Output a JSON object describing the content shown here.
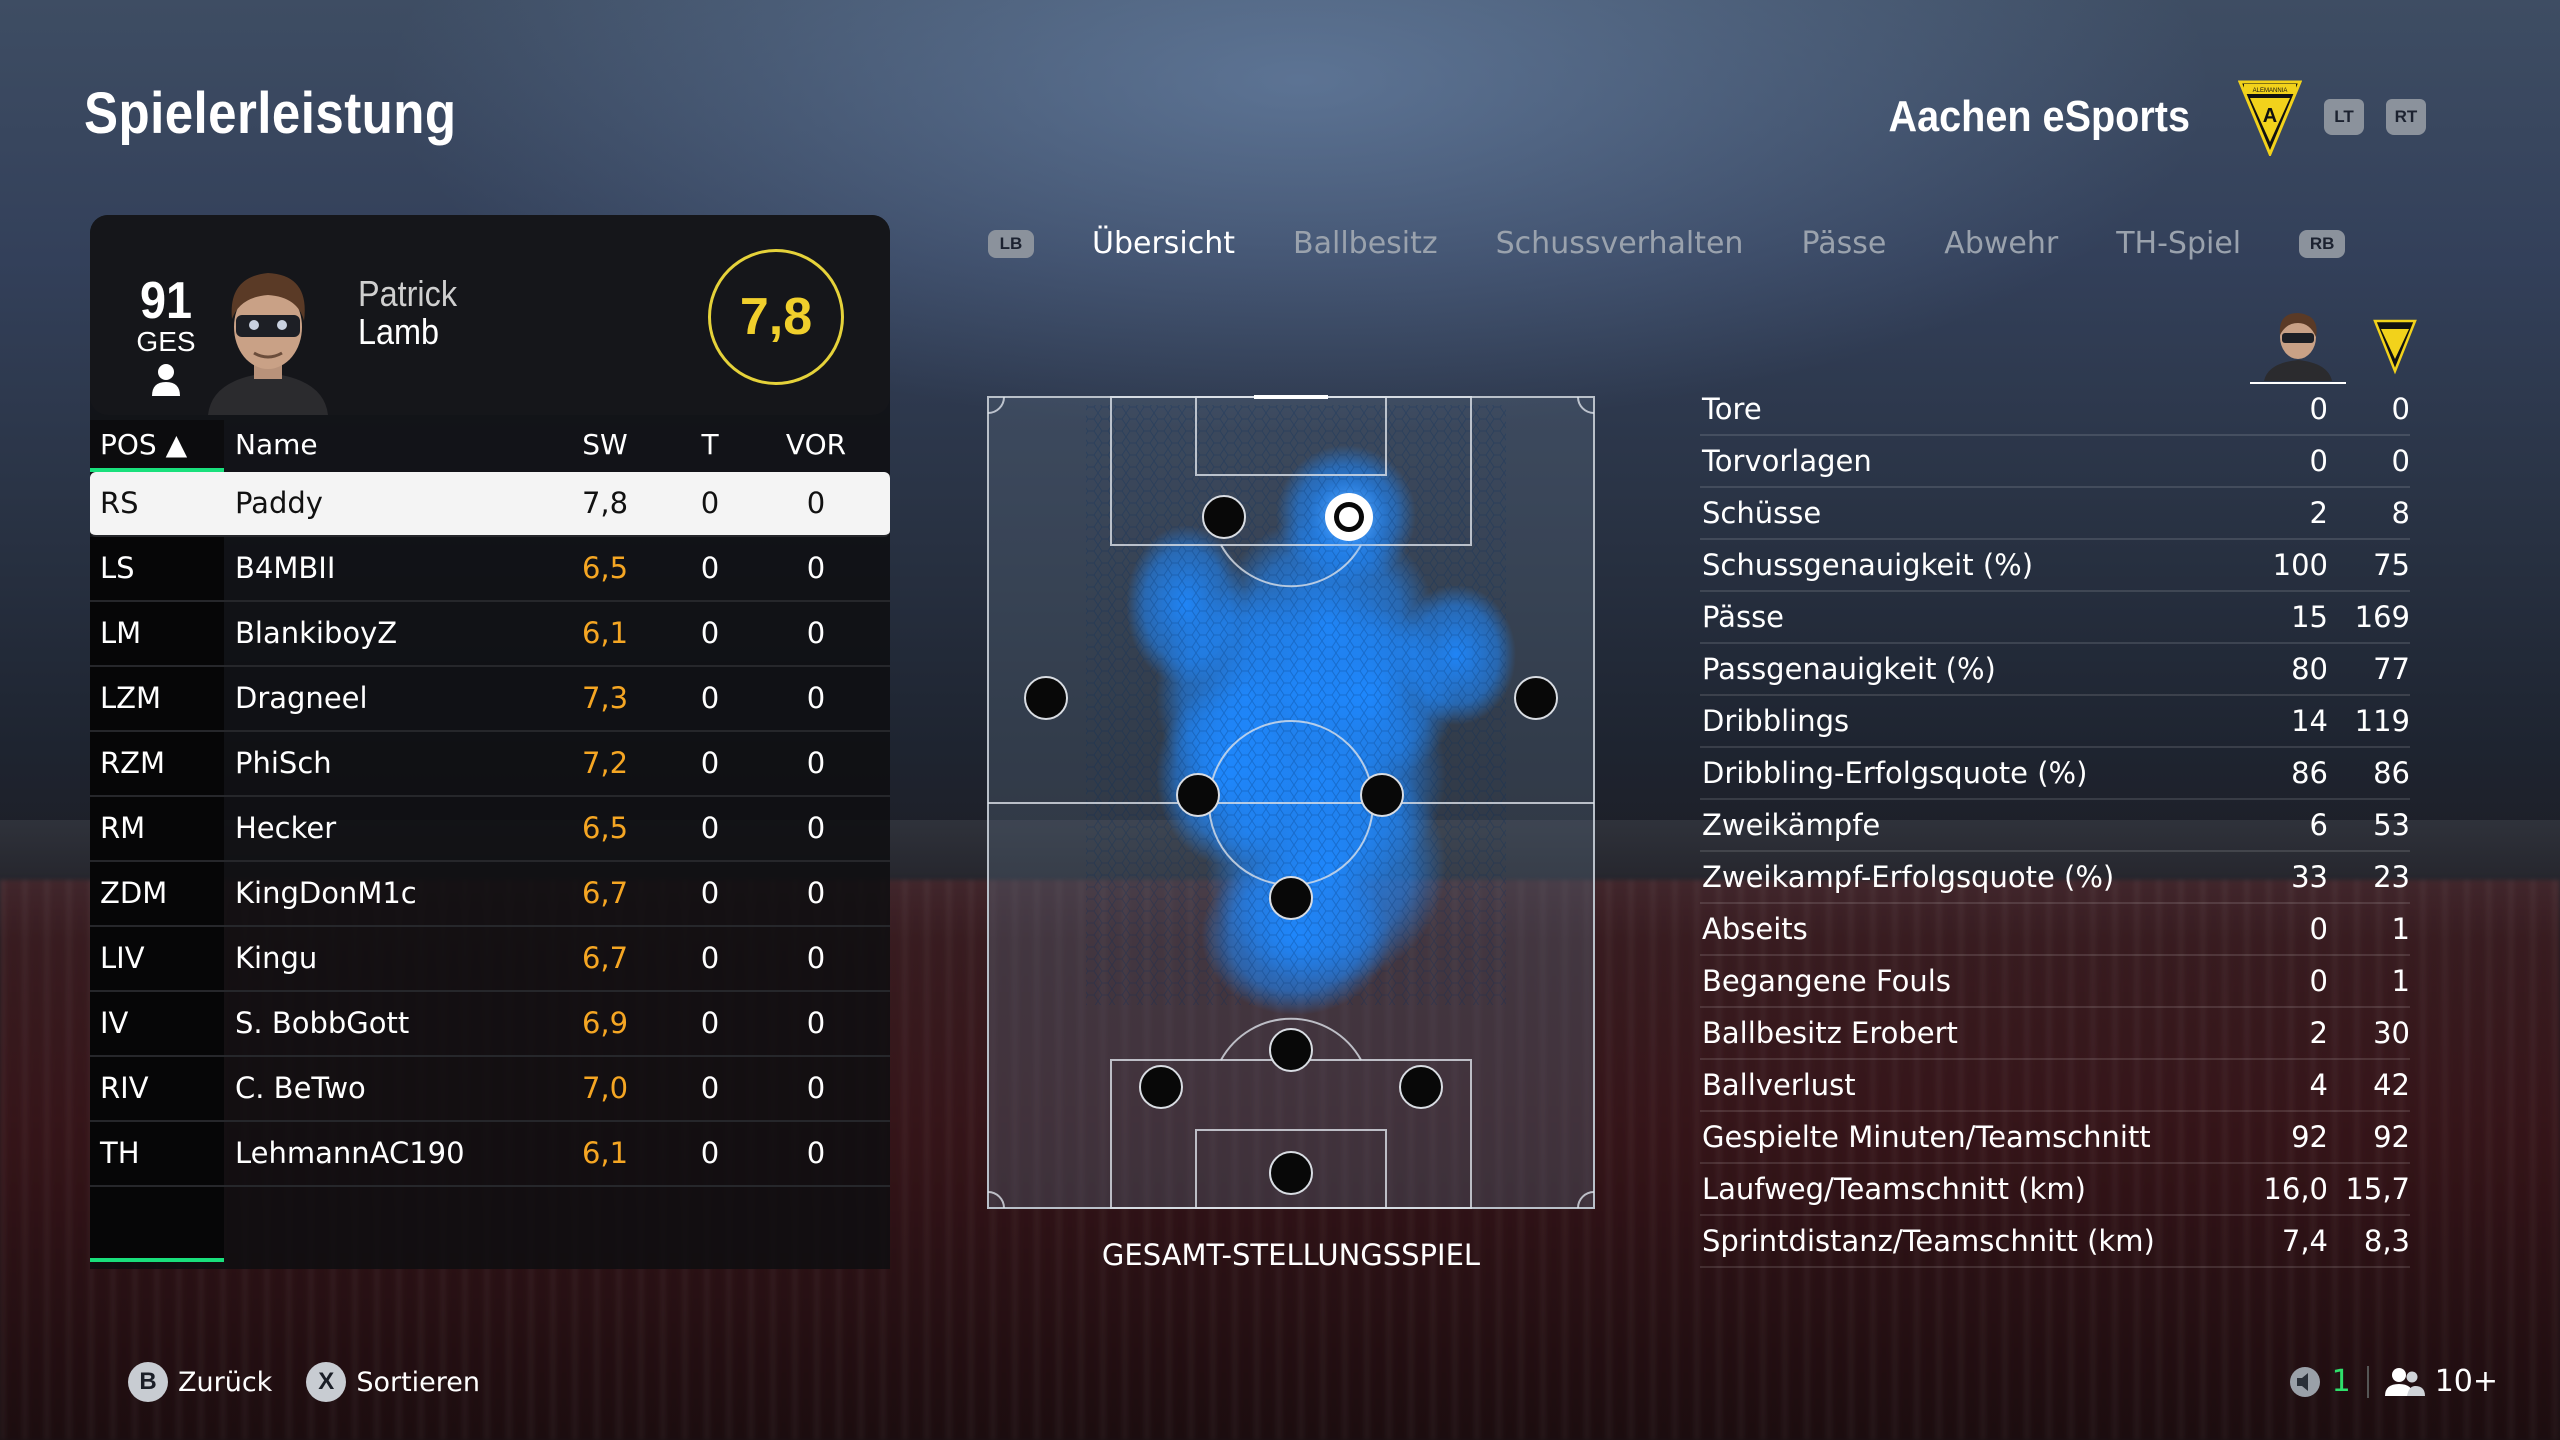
{
  "page_title": "Spielerleistung",
  "team": {
    "name": "Aachen eSports",
    "crest_text": "ALEMANNIA",
    "crest_letter": "A",
    "buttons": [
      "LT",
      "RT"
    ]
  },
  "player": {
    "overall": "91",
    "overall_label": "GES",
    "first_name": "Patrick",
    "last_name": "Lamb",
    "rating": "7,8"
  },
  "table": {
    "headers": {
      "pos": "POS ▲",
      "name": "Name",
      "sw": "SW",
      "t": "T",
      "vor": "VOR"
    },
    "rows": [
      {
        "pos": "RS",
        "name": "Paddy",
        "sw": "7,8",
        "t": "0",
        "vor": "0",
        "selected": true
      },
      {
        "pos": "LS",
        "name": "B4MBII",
        "sw": "6,5",
        "t": "0",
        "vor": "0"
      },
      {
        "pos": "LM",
        "name": "BlankiboyZ",
        "sw": "6,1",
        "t": "0",
        "vor": "0"
      },
      {
        "pos": "LZM",
        "name": "Dragneel",
        "sw": "7,3",
        "t": "0",
        "vor": "0"
      },
      {
        "pos": "RZM",
        "name": "PhiSch",
        "sw": "7,2",
        "t": "0",
        "vor": "0"
      },
      {
        "pos": "RM",
        "name": "Hecker",
        "sw": "6,5",
        "t": "0",
        "vor": "0"
      },
      {
        "pos": "ZDM",
        "name": "KingDonM1c",
        "sw": "6,7",
        "t": "0",
        "vor": "0"
      },
      {
        "pos": "LIV",
        "name": "Kingu",
        "sw": "6,7",
        "t": "0",
        "vor": "0"
      },
      {
        "pos": "IV",
        "name": "S. BobbGott",
        "sw": "6,9",
        "t": "0",
        "vor": "0"
      },
      {
        "pos": "RIV",
        "name": "C. BeTwo",
        "sw": "7,0",
        "t": "0",
        "vor": "0"
      },
      {
        "pos": "TH",
        "name": "LehmannAC190",
        "sw": "6,1",
        "t": "0",
        "vor": "0"
      }
    ]
  },
  "tabs": {
    "left_bumper": "LB",
    "right_bumper": "RB",
    "items": [
      "Übersicht",
      "Ballbesitz",
      "Schussverhalten",
      "Pässe",
      "Abwehr",
      "TH-Spiel"
    ],
    "active": "Übersicht"
  },
  "pitch": {
    "label": "GESAMT-STELLUNGSSPIEL"
  },
  "stats": [
    {
      "label": "Tore",
      "player": "0",
      "team": "0"
    },
    {
      "label": "Torvorlagen",
      "player": "0",
      "team": "0"
    },
    {
      "label": "Schüsse",
      "player": "2",
      "team": "8"
    },
    {
      "label": "Schussgenauigkeit (%)",
      "player": "100",
      "team": "75"
    },
    {
      "label": "Pässe",
      "player": "15",
      "team": "169"
    },
    {
      "label": "Passgenauigkeit (%)",
      "player": "80",
      "team": "77"
    },
    {
      "label": "Dribblings",
      "player": "14",
      "team": "119"
    },
    {
      "label": "Dribbling-Erfolgsquote (%)",
      "player": "86",
      "team": "86"
    },
    {
      "label": "Zweikämpfe",
      "player": "6",
      "team": "53"
    },
    {
      "label": "Zweikampf-Erfolgsquote (%)",
      "player": "33",
      "team": "23"
    },
    {
      "label": "Abseits",
      "player": "0",
      "team": "1"
    },
    {
      "label": "Begangene Fouls",
      "player": "0",
      "team": "1"
    },
    {
      "label": "Ballbesitz Erobert",
      "player": "2",
      "team": "30"
    },
    {
      "label": "Ballverlust",
      "player": "4",
      "team": "42"
    },
    {
      "label": "Gespielte Minuten/Teamschnitt",
      "player": "92",
      "team": "92"
    },
    {
      "label": "Laufweg/Teamschnitt (km)",
      "player": "16,0",
      "team": "15,7"
    },
    {
      "label": "Sprintdistanz/Teamschnitt (km)",
      "player": "7,4",
      "team": "8,3"
    }
  ],
  "footer": {
    "back": {
      "button": "B",
      "label": "Zurück"
    },
    "sort": {
      "button": "X",
      "label": "Sortieren"
    },
    "count_green": "1",
    "count_players": "10+"
  },
  "colors": {
    "accent_green": "#19e07c",
    "rating_yellow": "#f0cf2c",
    "rating_orange": "#f5a623",
    "heatmap_blue": "#1e88ff"
  }
}
